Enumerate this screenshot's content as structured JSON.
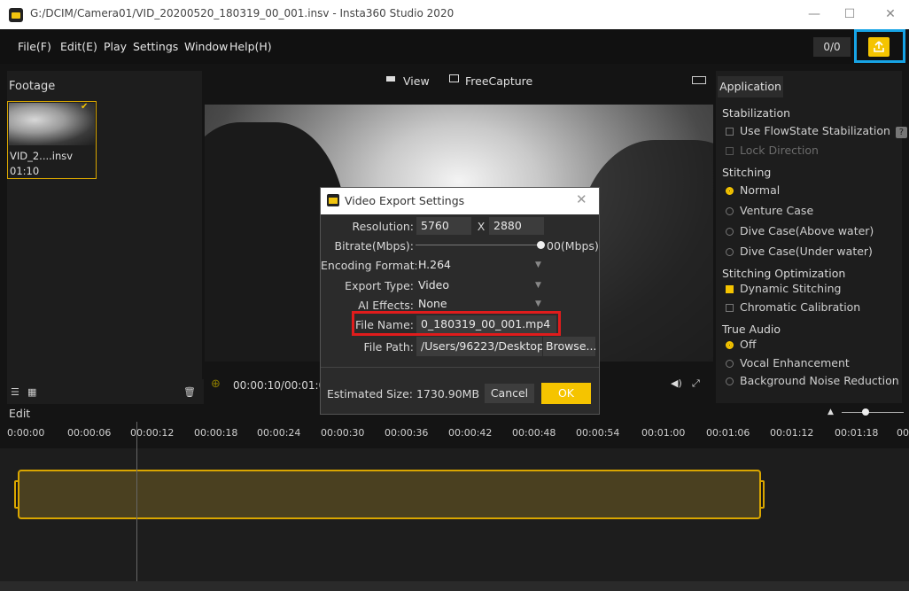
{
  "window": {
    "title": "G:/DCIM/Camera01/VID_20200520_180319_00_001.insv - Insta360 Studio 2020",
    "minimize": "—",
    "maximize": "☐",
    "close": "✕"
  },
  "menu": {
    "items": [
      "File(F)",
      "Edit(E)",
      "Play",
      "Settings",
      "Window",
      "Help(H)"
    ],
    "counter": "0/0",
    "export_icon": "export-upload-icon"
  },
  "footage": {
    "title": "Footage",
    "clip_name": "VID_2....insv",
    "clip_duration": "01:10"
  },
  "preview": {
    "view_label": "View",
    "freecapture_label": "FreeCapture",
    "timecode": "00:00:10/00:01:0"
  },
  "application": {
    "tab": "Application",
    "stabilization_title": "Stabilization",
    "use_flowstate": "Use FlowState Stabilization",
    "help": "?",
    "lock_direction": "Lock Direction",
    "stitching_title": "Stitching",
    "stitching_options": [
      "Normal",
      "Venture Case",
      "Dive Case(Above water)",
      "Dive Case(Under water)"
    ],
    "optimization_title": "Stitching Optimization",
    "dynamic_stitching": "Dynamic Stitching",
    "chromatic": "Chromatic Calibration",
    "audio_title": "True Audio",
    "audio_options": [
      "Off",
      "Vocal Enhancement",
      "Background Noise Reduction"
    ]
  },
  "edit": {
    "title": "Edit",
    "ticks": [
      "0:00:00",
      "00:00:06",
      "00:00:12",
      "00:00:18",
      "00:00:24",
      "00:00:30",
      "00:00:36",
      "00:00:42",
      "00:00:48",
      "00:00:54",
      "00:01:00",
      "00:01:06",
      "00:01:12",
      "00:01:18",
      "00"
    ]
  },
  "dialog": {
    "title": "Video Export Settings",
    "close": "✕",
    "resolution_label": "Resolution:",
    "res_w": "5760",
    "res_x": "X",
    "res_h": "2880",
    "bitrate_label": "Bitrate(Mbps):",
    "bitrate_value": "00(Mbps)",
    "encoding_label": "Encoding Format:",
    "encoding_value": "H.264",
    "export_type_label": "Export Type:",
    "export_type_value": "Video",
    "ai_effects_label": "AI Effects:",
    "ai_effects_value": "None",
    "file_name_label": "File Name:",
    "file_name_value": "0_180319_00_001.mp4",
    "file_path_label": "File Path:",
    "file_path_value": "/Users/96223/Desktop",
    "browse": "Browse...",
    "estimated_size": "Estimated Size: 1730.90MB",
    "cancel": "Cancel",
    "ok": "OK"
  },
  "colors": {
    "accent": "#f5c400",
    "highlight_export": "#17a4e6",
    "highlight_filename": "#e01c1c"
  }
}
